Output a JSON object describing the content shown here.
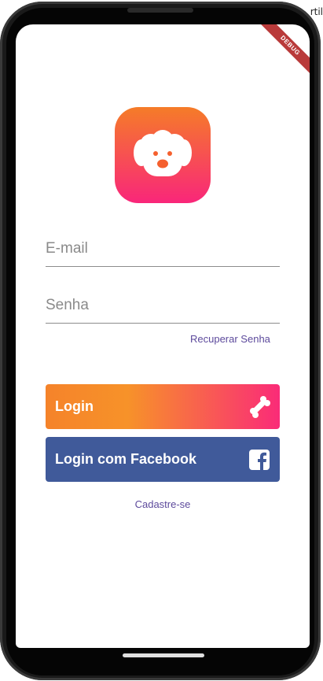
{
  "background_fragment": "rtil",
  "debug_banner": "DEBUG",
  "login_form": {
    "email_placeholder": "E-mail",
    "password_placeholder": "Senha",
    "recover_link": "Recuperar Senha"
  },
  "buttons": {
    "login_label": "Login",
    "facebook_label": "Login com Facebook"
  },
  "signup_link": "Cadastre-se",
  "icons": {
    "logo": "dog-face-icon",
    "login": "bone-icon",
    "facebook": "facebook-icon"
  },
  "colors": {
    "gradient_start": "#f57c28",
    "gradient_end": "#f9267a",
    "facebook_blue": "#405a9a",
    "link_purple": "#5d4a9c"
  }
}
